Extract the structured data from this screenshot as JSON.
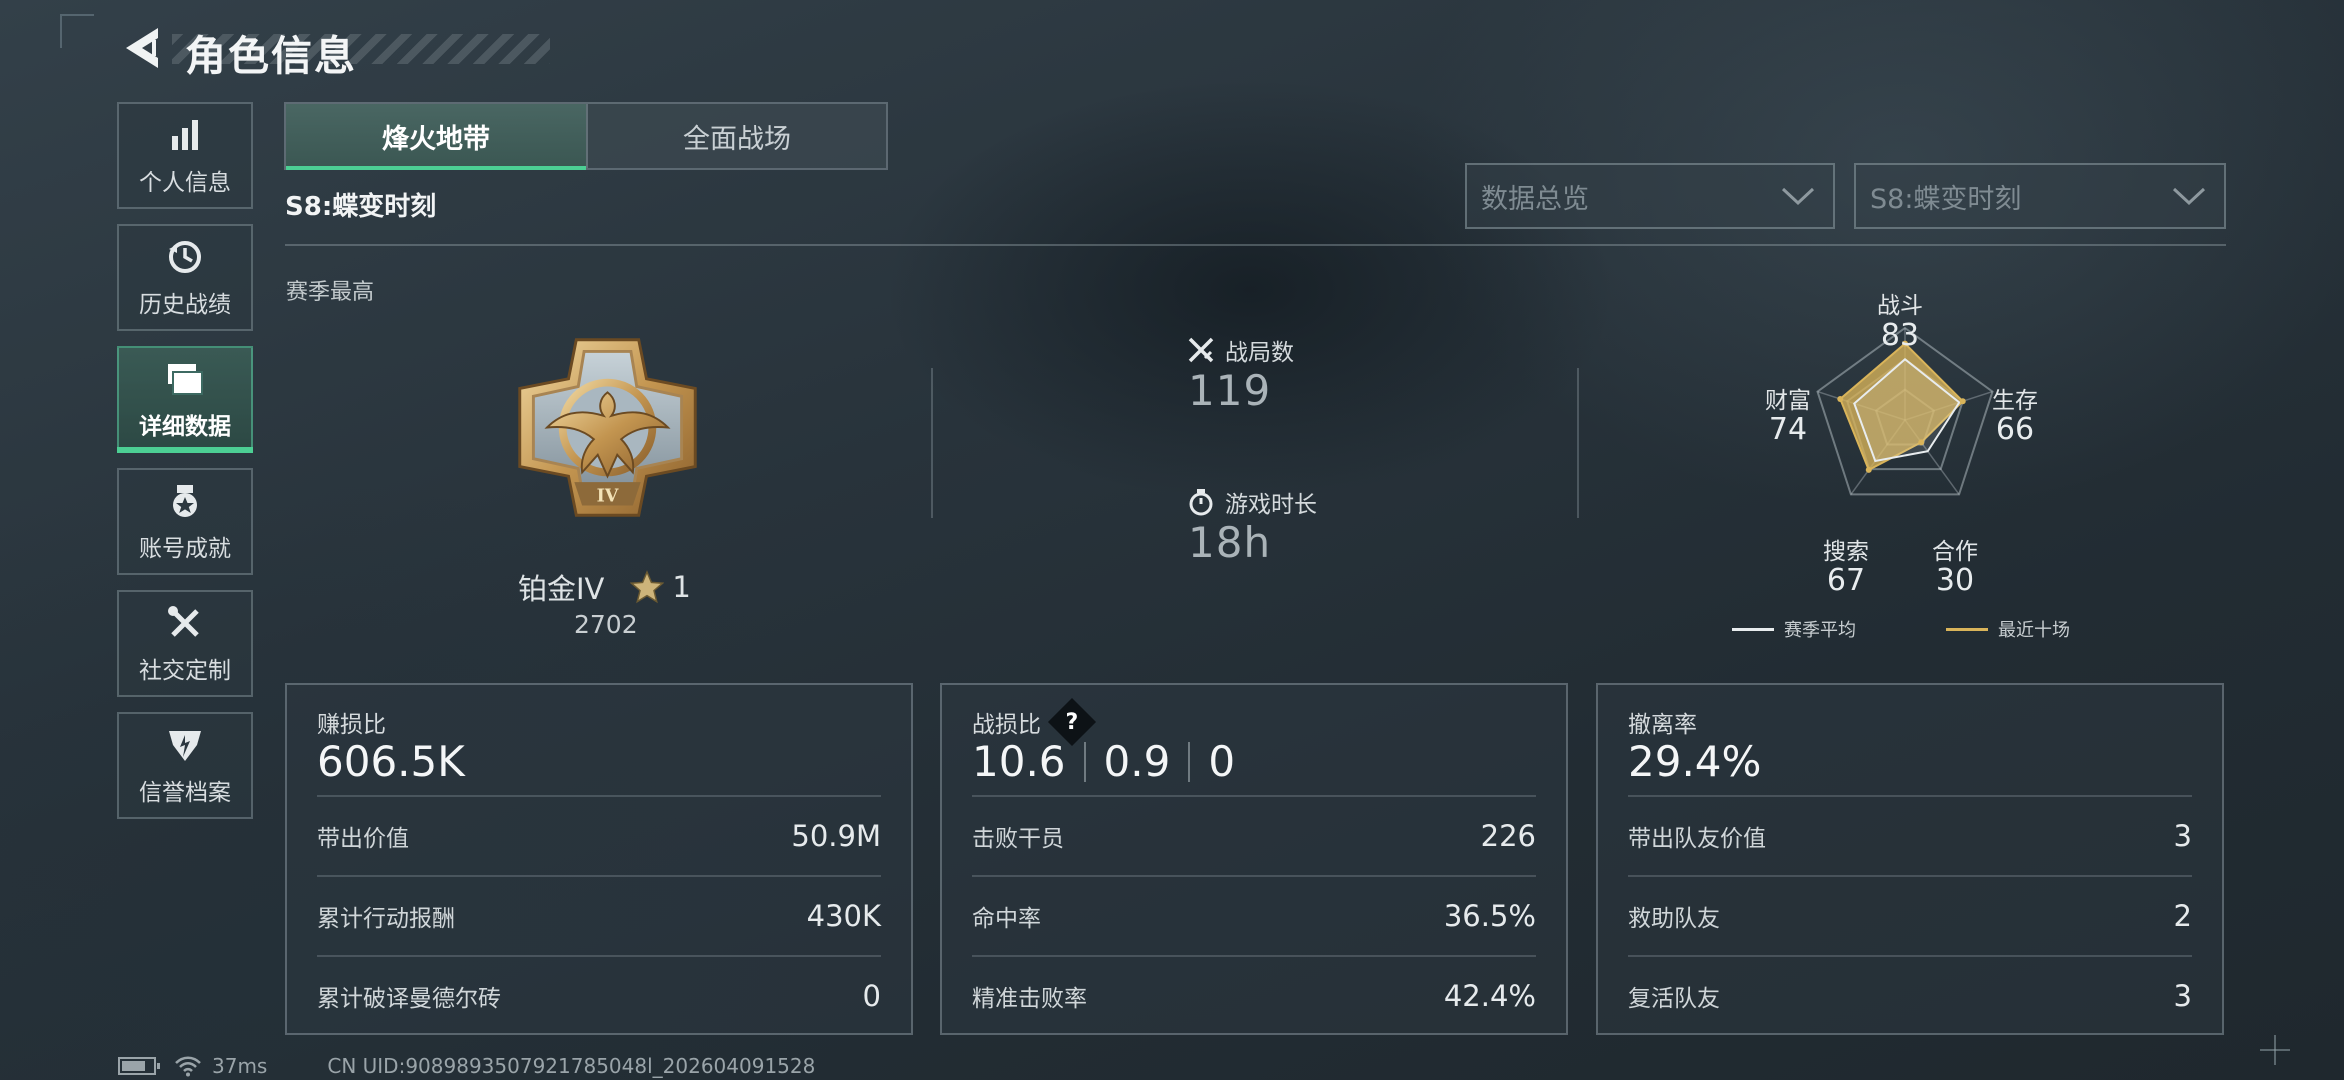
{
  "header": {
    "title": "角色信息"
  },
  "sidebar": {
    "items": [
      {
        "label": "个人信息",
        "icon": "bar-chart-icon"
      },
      {
        "label": "历史战绩",
        "icon": "history-clock-icon"
      },
      {
        "label": "详细数据",
        "icon": "folder-stack-icon",
        "active": true
      },
      {
        "label": "账号成就",
        "icon": "achievement-medal-icon"
      },
      {
        "label": "社交定制",
        "icon": "wrench-screwdriver-icon"
      },
      {
        "label": "信誉档案",
        "icon": "credit-shield-icon"
      }
    ]
  },
  "tabs": [
    {
      "label": "烽火地带",
      "active": true
    },
    {
      "label": "全面战场",
      "active": false
    }
  ],
  "season_label": "S8:蝶变时刻",
  "filters": {
    "overview": "数据总览",
    "season": "S8:蝶变时刻"
  },
  "season_best": {
    "label": "赛季最高",
    "rank_name": "铂金IV",
    "stars": "1",
    "score": "2702",
    "medal_numeral": "IV"
  },
  "summary": {
    "matches_label": "战局数",
    "matches_value": "119",
    "playtime_label": "游戏时长",
    "playtime_value": "18h"
  },
  "radar": {
    "axes": [
      {
        "label": "战斗",
        "value": "83"
      },
      {
        "label": "生存",
        "value": "66"
      },
      {
        "label": "合作",
        "value": "30"
      },
      {
        "label": "搜索",
        "value": "67"
      },
      {
        "label": "财富",
        "value": "74"
      }
    ],
    "season_avg": [
      0.66,
      0.62,
      0.42,
      0.55,
      0.58
    ],
    "recent_ten": [
      0.83,
      0.66,
      0.3,
      0.67,
      0.74
    ],
    "legend": {
      "season_avg": "赛季平均",
      "recent_ten": "最近十场"
    },
    "colors": {
      "season_avg": "#e8ecee",
      "recent_ten": "#d9b45a"
    }
  },
  "cards": {
    "profit": {
      "title": "赚损比",
      "main": "606.5K",
      "rows": [
        {
          "label": "带出价值",
          "value": "50.9M"
        },
        {
          "label": "累计行动报酬",
          "value": "430K"
        },
        {
          "label": "累计破译曼德尔砖",
          "value": "0"
        }
      ]
    },
    "kd": {
      "title": "战损比",
      "help": "?",
      "main": [
        "10.6",
        "0.9",
        "0"
      ],
      "rows": [
        {
          "label": "击败干员",
          "value": "226"
        },
        {
          "label": "命中率",
          "value": "36.5%"
        },
        {
          "label": "精准击败率",
          "value": "42.4%"
        }
      ]
    },
    "extract": {
      "title": "撤离率",
      "main": "29.4%",
      "rows": [
        {
          "label": "带出队友价值",
          "value": "3"
        },
        {
          "label": "救助队友",
          "value": "2"
        },
        {
          "label": "复活队友",
          "value": "3"
        }
      ]
    }
  },
  "footer": {
    "ping": "37ms",
    "uid": "CN UID:9089893507921785048l_202604091528"
  }
}
